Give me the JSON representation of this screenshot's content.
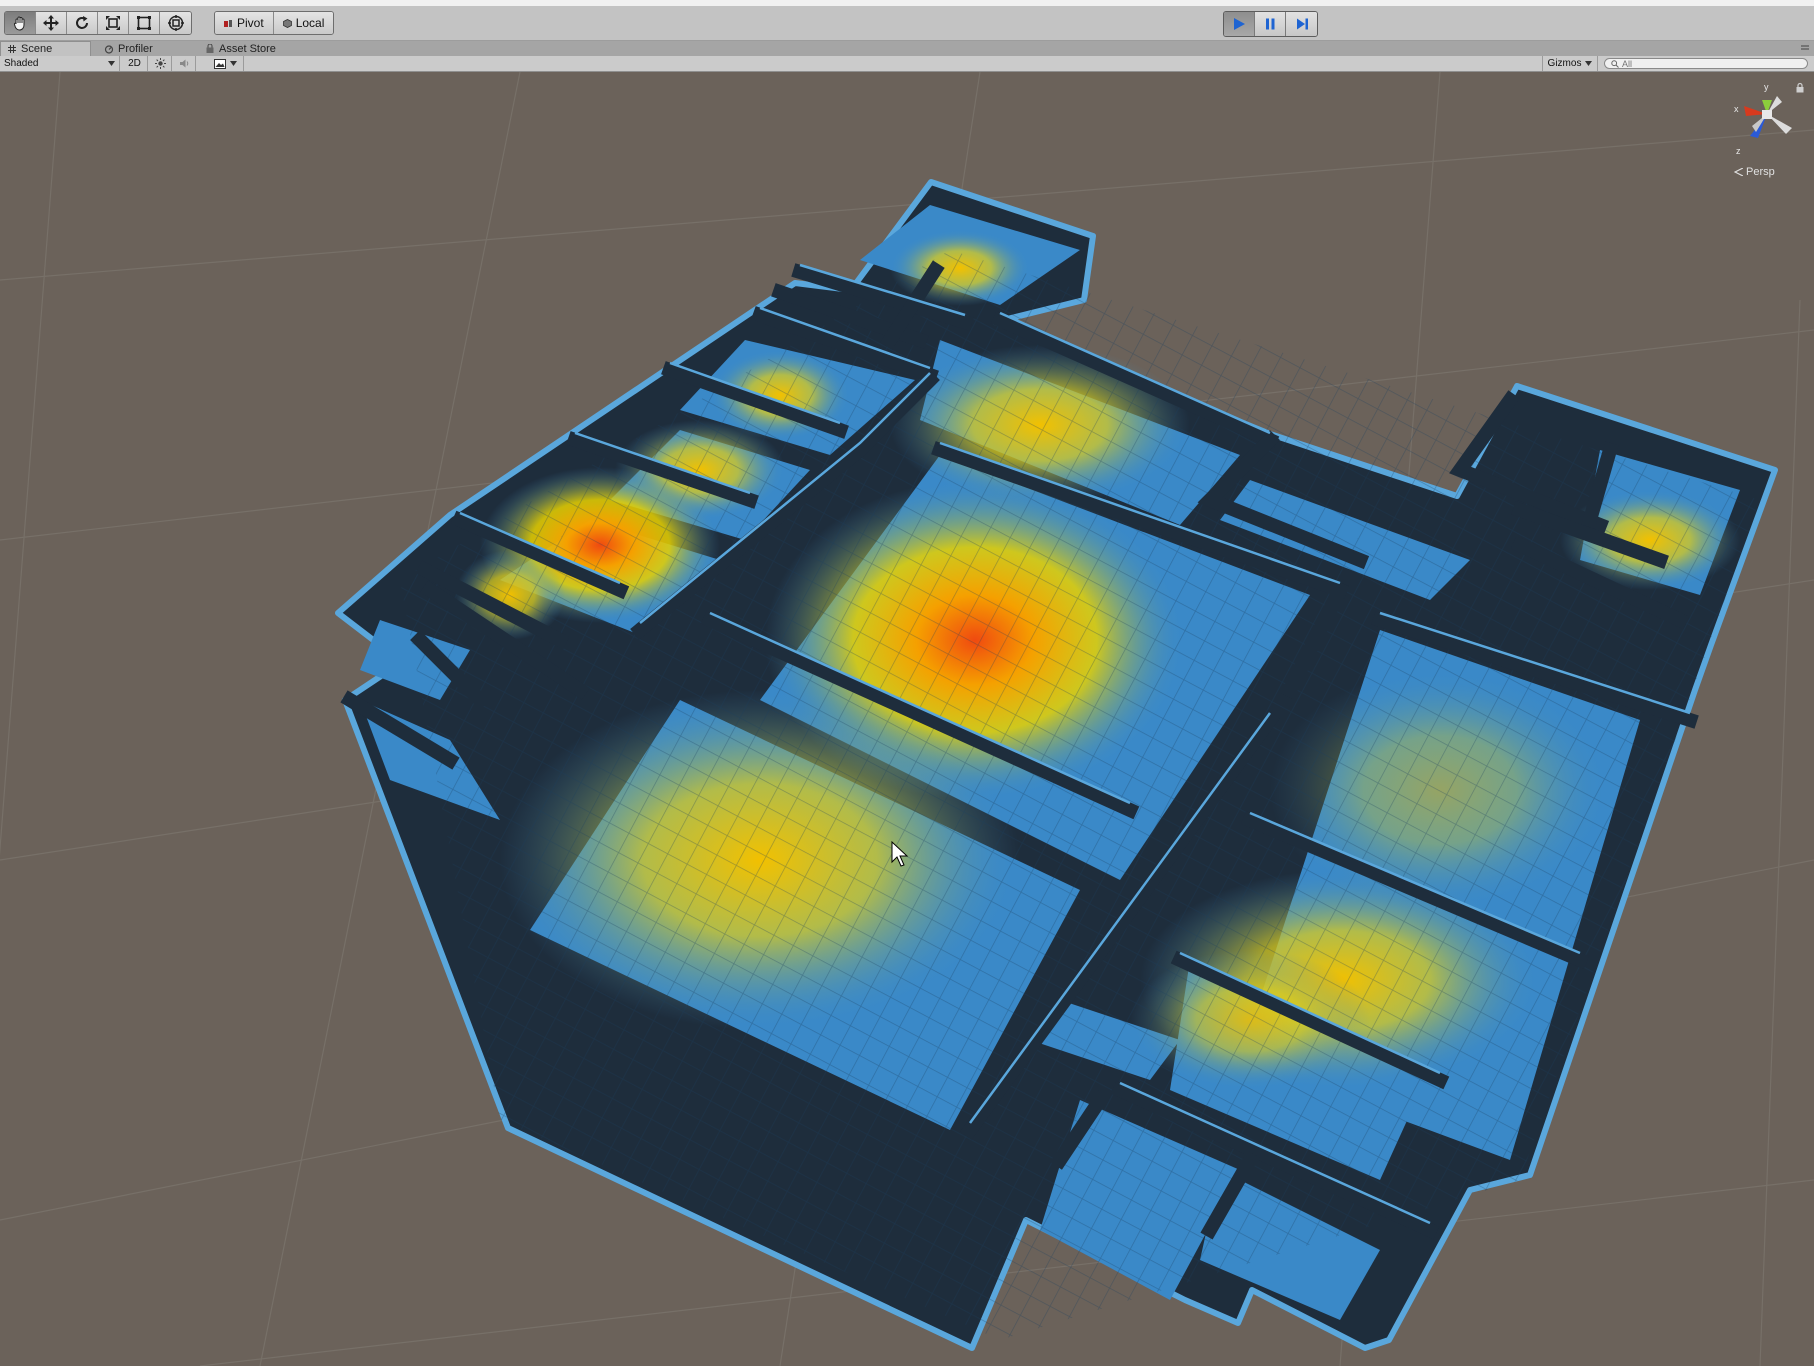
{
  "toolbar": {
    "tools": [
      {
        "name": "hand-tool",
        "icon": "hand-icon"
      },
      {
        "name": "move-tool",
        "icon": "move-arrows-icon"
      },
      {
        "name": "rotate-tool",
        "icon": "rotate-icon"
      },
      {
        "name": "scale-tool",
        "icon": "scale-icon"
      },
      {
        "name": "rect-tool",
        "icon": "rect-icon"
      },
      {
        "name": "transform-tool",
        "icon": "transform-icon"
      }
    ],
    "pivot_label": "Pivot",
    "local_label": "Local",
    "play_icon": "play-icon",
    "pause_icon": "pause-icon",
    "step_icon": "step-icon"
  },
  "tabs": {
    "scene": "Scene",
    "profiler": "Profiler",
    "asset_store": "Asset Store"
  },
  "scene_toolbar": {
    "draw_mode": "Shaded",
    "mode_2d": "2D",
    "gizmos": "Gizmos",
    "search_placeholder": "All"
  },
  "gizmo": {
    "axis_x": "x",
    "axis_y": "y",
    "axis_z": "z",
    "projection": "Persp"
  },
  "colors": {
    "ground": "#6b625a",
    "wall": "#1e2d3c",
    "floor": "#3a89c8",
    "heat_hot": "#f05a10",
    "heat_mid": "#f0c800",
    "play_active": "#1e64d2"
  }
}
